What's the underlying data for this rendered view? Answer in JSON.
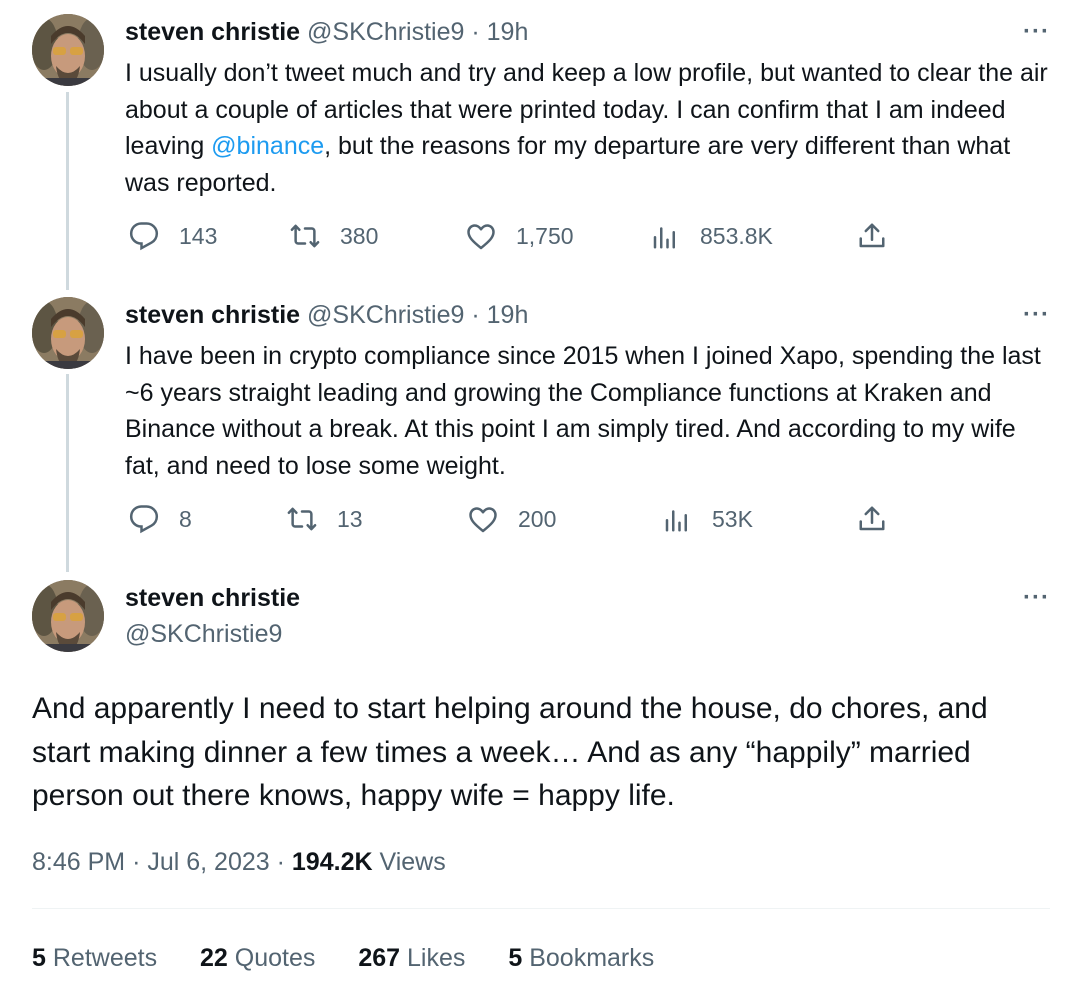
{
  "author": {
    "name": "steven christie",
    "handle": "@SKChristie9"
  },
  "more_label": "···",
  "tweets": [
    {
      "time": "19h",
      "text_before": "I usually don’t tweet much and try and keep a low profile, but wanted to clear the air about a couple of articles that were printed today. I can confirm that I am indeed leaving ",
      "mention": "@binance",
      "text_after": ", but the reasons for my departure are very different than what was reported.",
      "replies": "143",
      "retweets": "380",
      "likes": "1,750",
      "views": "853.8K"
    },
    {
      "time": "19h",
      "text": "I have been in crypto compliance since 2015 when I joined Xapo, spending the last ~6 years straight leading and growing the Compliance functions at Kraken and Binance without a break. At this point I am simply tired. And according to my wife fat, and need to lose some weight.",
      "replies": "8",
      "retweets": "13",
      "likes": "200",
      "views": "53K"
    }
  ],
  "main_tweet": {
    "text": "And apparently I need to start helping around the house, do chores, and start making dinner a few times a week… And as any “happily” married person out there knows, happy wife = happy life.",
    "time": "8:46 PM",
    "date": "Jul 6, 2023",
    "views_count": "194.2K",
    "views_label": "Views",
    "stats": {
      "retweets_count": "5",
      "retweets_label": "Retweets",
      "quotes_count": "22",
      "quotes_label": "Quotes",
      "likes_count": "267",
      "likes_label": "Likes",
      "bookmarks_count": "5",
      "bookmarks_label": "Bookmarks"
    }
  },
  "icons": {
    "reply": "reply-icon",
    "retweet": "retweet-icon",
    "like": "heart-icon",
    "views": "views-chart-icon",
    "share": "share-icon",
    "more": "more-icon"
  },
  "colors": {
    "text": "#0f1419",
    "secondary": "#536471",
    "mention": "#1d9bf0",
    "thread_line": "#cfd9de"
  }
}
